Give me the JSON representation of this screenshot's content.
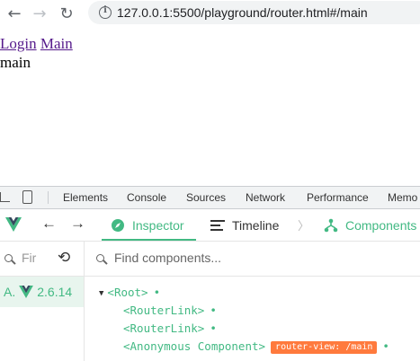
{
  "browser": {
    "url": "127.0.0.1:5500/playground/router.html#/main"
  },
  "page": {
    "links": [
      "Login",
      "Main"
    ],
    "content": "main"
  },
  "devtools": {
    "tabs": [
      "Elements",
      "Console",
      "Sources",
      "Network",
      "Performance",
      "Memo"
    ]
  },
  "vue_devtools": {
    "tabs": {
      "inspector": "Inspector",
      "timeline": "Timeline",
      "components": "Components"
    },
    "app_search_placeholder": "Fir",
    "app": {
      "label": "A.",
      "version": "2.6.14"
    },
    "component_search_placeholder": "Find components...",
    "tree": [
      {
        "label": "<Root>",
        "expanded": true
      },
      {
        "label": "<RouterLink>"
      },
      {
        "label": "<RouterLink>"
      },
      {
        "label": "<Anonymous Component>",
        "badge": "router-view: /main"
      }
    ],
    "colors": {
      "accent": "#42b983",
      "badge": "#ff7a3d"
    }
  }
}
